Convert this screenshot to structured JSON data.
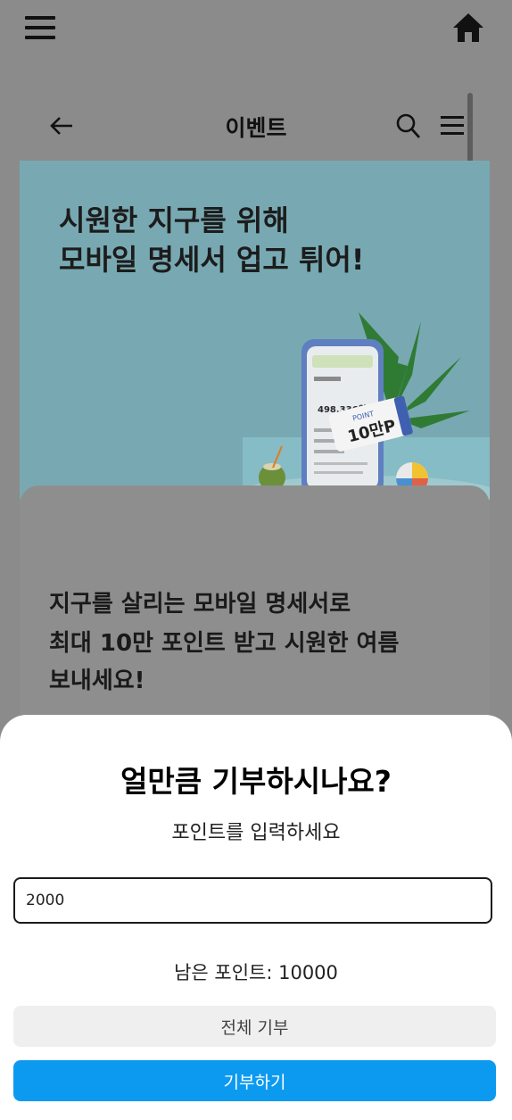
{
  "app_bar": {
    "menu_icon": "hamburger-icon",
    "home_icon": "home-icon"
  },
  "webview": {
    "title": "이벤트",
    "back_icon": "arrow-left-icon",
    "search_icon": "search-icon",
    "menu_icon": "menu-icon"
  },
  "banner": {
    "headline_line1": "시원한 지구를 위해",
    "headline_line2": "모바일 명세서 업고 튀어!",
    "illustration": {
      "ticket_label": "POINT",
      "ticket_value": "10만P",
      "phone_amount": "498,336원"
    }
  },
  "event_card": {
    "line1": "지구를 살리는 모바일 명세서로",
    "line2": "최대 10만 포인트 받고 시원한 여름",
    "line3": "보내세요!"
  },
  "donation_sheet": {
    "title": "얼만큼 기부하시나요?",
    "subtitle": "포인트를 입력하세요",
    "amount_value": "2000",
    "remaining_text": "남은 포인트: 10000",
    "donate_all_label": "전체 기부",
    "donate_label": "기부하기"
  },
  "colors": {
    "accent": "#0c9af1",
    "overlay": "#8b8b8b",
    "banner_bg": "#78a9b2"
  }
}
